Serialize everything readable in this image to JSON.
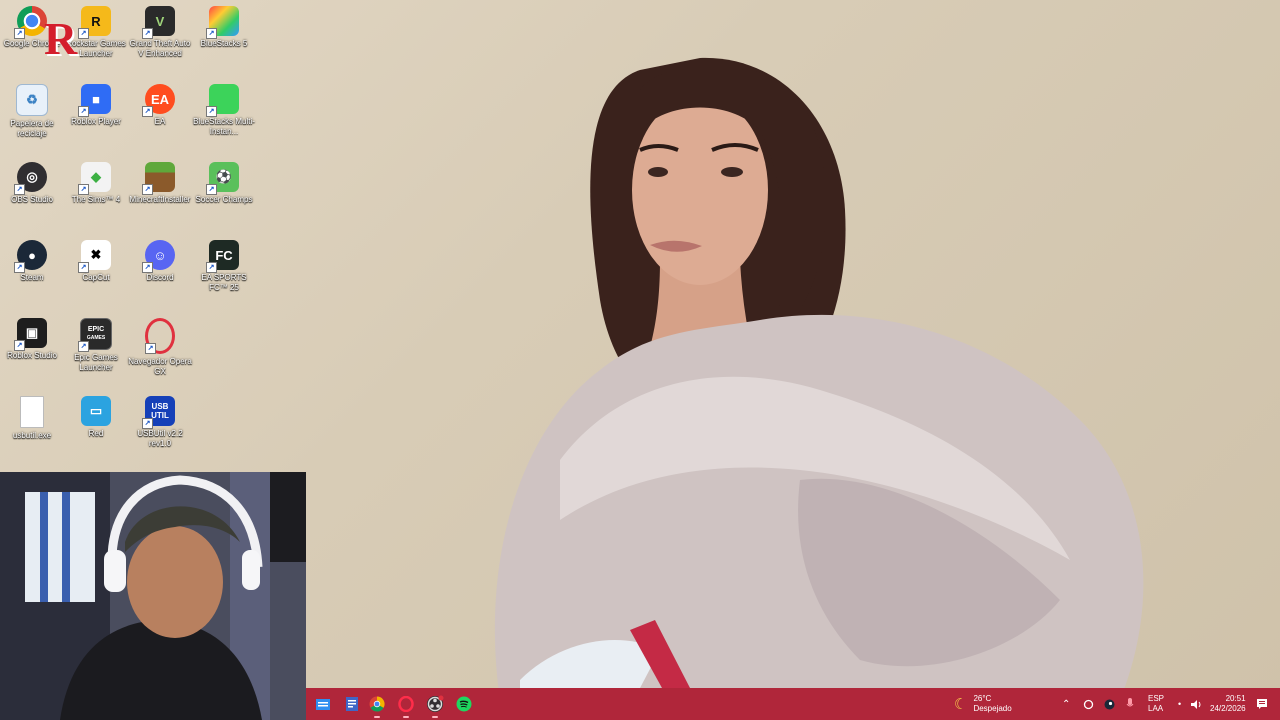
{
  "desktop": {
    "overlay_badge": "R",
    "icons": [
      {
        "label": "Google Chrome",
        "icon": "chrome-icon"
      },
      {
        "label": "Rockstar Games Launcher",
        "icon": "rockstar-icon"
      },
      {
        "label": "Grand Theft Auto V Enhanced",
        "icon": "gta-icon"
      },
      {
        "label": "BlueStacks 5",
        "icon": "bluestacks-icon"
      },
      {
        "label": "Papelera de reciclaje",
        "icon": "recycle-bin-icon"
      },
      {
        "label": "Roblox Player",
        "icon": "roblox-icon"
      },
      {
        "label": "EA",
        "icon": "ea-icon"
      },
      {
        "label": "BlueStacks Multi-Instan...",
        "icon": "bluestacks-multi-icon"
      },
      {
        "label": "OBS Studio",
        "icon": "obs-icon"
      },
      {
        "label": "The Sims™ 4",
        "icon": "sims-icon"
      },
      {
        "label": "MinecraftInstaller",
        "icon": "minecraft-icon"
      },
      {
        "label": "Soccer Champs",
        "icon": "soccer-champs-icon"
      },
      {
        "label": "Steam",
        "icon": "steam-icon"
      },
      {
        "label": "CapCut",
        "icon": "capcut-icon"
      },
      {
        "label": "Discord",
        "icon": "discord-icon"
      },
      {
        "label": "EA SPORTS FC™ 25",
        "icon": "ea-fc-icon"
      },
      {
        "label": "Roblox Studio",
        "icon": "roblox-studio-icon"
      },
      {
        "label": "Epic Games Launcher",
        "icon": "epic-games-icon"
      },
      {
        "label": "Navegador Opera GX",
        "icon": "opera-gx-icon"
      },
      {
        "label": "usbutil.exe",
        "icon": "file-icon"
      },
      {
        "label": "Red",
        "icon": "network-icon"
      },
      {
        "label": "USBUtil v2.2 rev1.0",
        "icon": "usbutil-icon"
      }
    ],
    "glyphs": {
      "epic": "EPIC",
      "epic_sub": "GAMES",
      "usb": "USB",
      "usb_sub": "UTIL",
      "fc": "FC"
    }
  },
  "taskbar": {
    "apps": [
      "file-explorer-icon",
      "notepad-icon",
      "chrome-icon",
      "opera-gx-icon",
      "obs-icon",
      "spotify-icon"
    ],
    "weather": {
      "temp": "26°C",
      "condition": "Despejado"
    },
    "language": {
      "line1": "ESP",
      "line2": "LAA"
    },
    "clock": {
      "time": "20:51",
      "date": "24/2/2026"
    }
  },
  "colors": {
    "taskbar": "#b0263a",
    "accent": "#e0313f"
  }
}
